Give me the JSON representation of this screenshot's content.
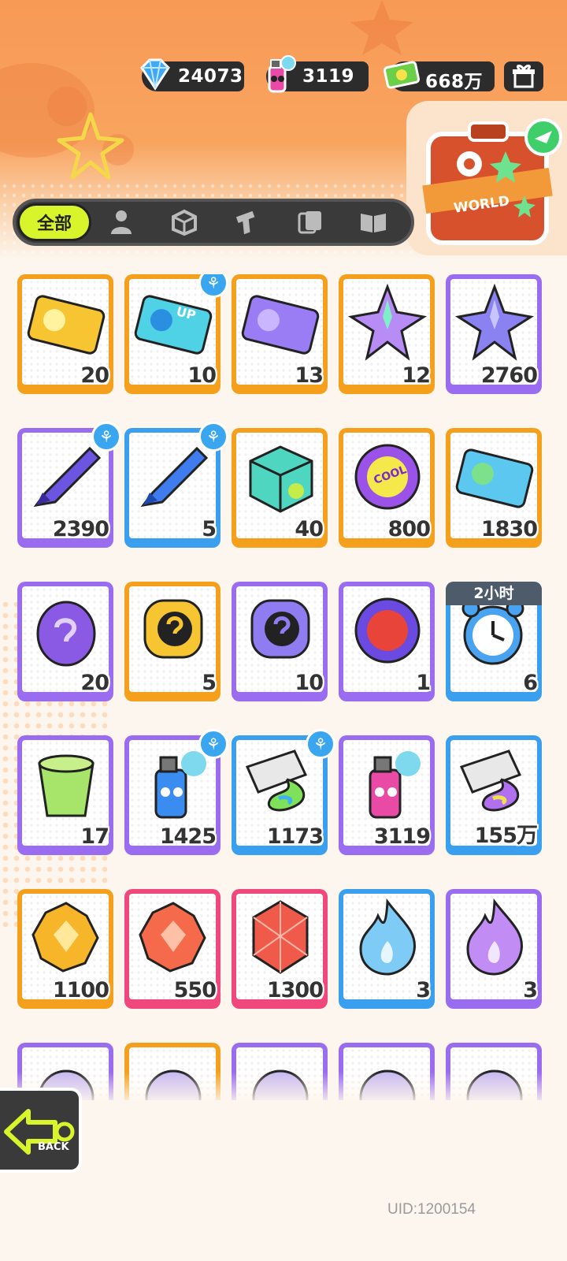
{
  "currencies": [
    {
      "name": "diamond-icon",
      "value": "24073"
    },
    {
      "name": "spray-can-icon",
      "value": "3119"
    },
    {
      "name": "cash-icon",
      "value": "668万"
    }
  ],
  "world": {
    "label": "WORLD"
  },
  "tabs": [
    {
      "label": "全部",
      "icon": "all"
    },
    {
      "icon": "person-icon"
    },
    {
      "icon": "box-icon"
    },
    {
      "icon": "spray-gun-icon"
    },
    {
      "icon": "cards-icon"
    },
    {
      "icon": "book-icon"
    }
  ],
  "items": [
    {
      "count": "20",
      "frame": "orange",
      "art": "ticket-gold-icon"
    },
    {
      "count": "10",
      "frame": "orange",
      "art": "ticket-up-icon",
      "badge": true,
      "ticket_text": "UP"
    },
    {
      "count": "13",
      "frame": "orange",
      "art": "ticket-purple-icon"
    },
    {
      "count": "12",
      "frame": "orange",
      "art": "rainbow-star-icon"
    },
    {
      "count": "2760",
      "frame": "purple",
      "art": "purple-star-icon"
    },
    {
      "count": "2390",
      "frame": "purple",
      "art": "purple-crayon-icon",
      "badge": true
    },
    {
      "count": "5",
      "frame": "blue",
      "art": "blue-crayon-icon",
      "badge": true
    },
    {
      "count": "40",
      "frame": "orange",
      "art": "color-box-icon"
    },
    {
      "count": "800",
      "frame": "orange",
      "art": "cool-badge-icon",
      "badge_text": "COOL"
    },
    {
      "count": "1830",
      "frame": "orange",
      "art": "season-ticket-icon"
    },
    {
      "count": "20",
      "frame": "purple",
      "art": "mystery-egg-icon"
    },
    {
      "count": "5",
      "frame": "orange",
      "art": "mystery-deity-gold-icon"
    },
    {
      "count": "10",
      "frame": "purple",
      "art": "mystery-deity-purple-icon"
    },
    {
      "count": "1",
      "frame": "purple",
      "art": "piranha-badge-icon"
    },
    {
      "count": "6",
      "frame": "blue",
      "art": "alarm-clock-icon",
      "timer": "2小时"
    },
    {
      "count": "17",
      "frame": "purple",
      "art": "open-cup-icon"
    },
    {
      "count": "1425",
      "frame": "purple",
      "art": "blue-spray-can-icon",
      "badge": true
    },
    {
      "count": "1173",
      "frame": "blue",
      "art": "paint-tube-green-icon",
      "badge": true
    },
    {
      "count": "3119",
      "frame": "purple",
      "art": "pink-spray-can-icon"
    },
    {
      "count": "155万",
      "frame": "blue",
      "art": "paint-tube-rainbow-icon"
    },
    {
      "count": "1100",
      "frame": "orange",
      "art": "gold-crystal-icon"
    },
    {
      "count": "550",
      "frame": "pink",
      "art": "red-crystal-icon"
    },
    {
      "count": "1300",
      "frame": "pink",
      "art": "red-gem-icon"
    },
    {
      "count": "3",
      "frame": "blue",
      "art": "blue-flame-icon"
    },
    {
      "count": "3",
      "frame": "purple",
      "art": "purple-flame-icon"
    },
    {
      "count": "",
      "frame": "purple",
      "art": "partial-item-icon"
    },
    {
      "count": "",
      "frame": "orange",
      "art": "partial-item-icon"
    },
    {
      "count": "",
      "frame": "purple",
      "art": "partial-item-icon"
    },
    {
      "count": "",
      "frame": "purple",
      "art": "partial-item-icon"
    },
    {
      "count": "",
      "frame": "purple",
      "art": "partial-item-icon"
    }
  ],
  "back": {
    "label": "BACK"
  },
  "uid": "UID:1200154",
  "colors": {
    "orange": "#f5a01c",
    "purple": "#9a6cf0",
    "blue": "#3b9ff0",
    "pink": "#f0487c",
    "accent": "#d8f52b"
  }
}
